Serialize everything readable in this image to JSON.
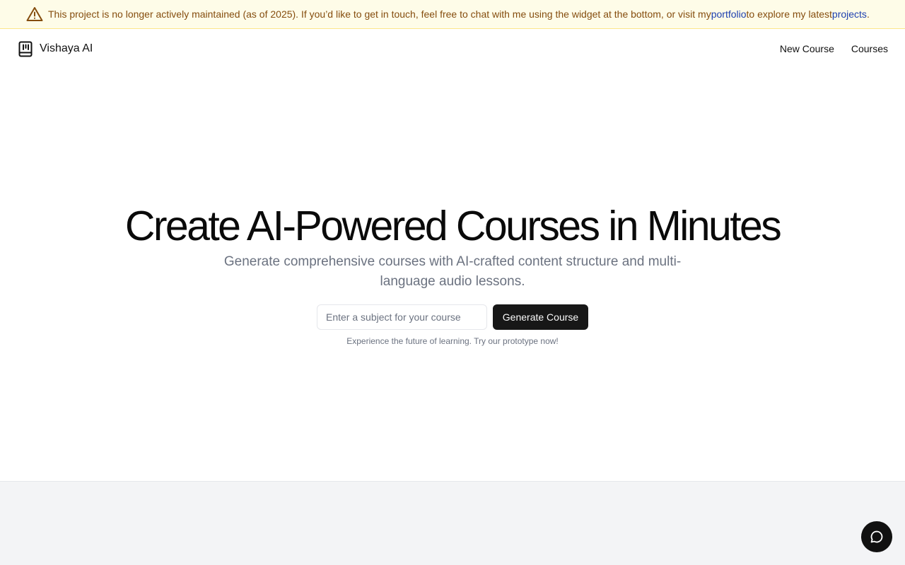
{
  "banner": {
    "text_before": "This project is no longer actively maintained (as of 2025). If you’d like to get in touch, feel free to chat with me using the widget at the bottom, or visit my ",
    "portfolio_link": "portfolio",
    "text_middle": " to explore my latest ",
    "projects_link": "projects",
    "text_after": ".",
    "icon": "warning-triangle-icon"
  },
  "header": {
    "brand_name": "Vishaya AI",
    "brand_icon": "book-icon",
    "nav": {
      "new_course": "New Course",
      "courses": "Courses"
    }
  },
  "hero": {
    "title": "Create AI-Powered Courses in Minutes",
    "subtitle": "Generate comprehensive courses with AI-crafted content structure and multi-language audio lessons.",
    "input_placeholder": "Enter a subject for your course",
    "input_value": "",
    "generate_button": "Generate Course",
    "note": "Experience the future of learning. Try our prototype now!"
  },
  "chat_widget": {
    "icon": "chat-bubble-icon"
  },
  "colors": {
    "banner_bg": "#fefce8",
    "banner_text": "#854d0e",
    "link": "#1e40af",
    "primary_button": "#171717",
    "footer_bg": "#f3f4f6"
  }
}
